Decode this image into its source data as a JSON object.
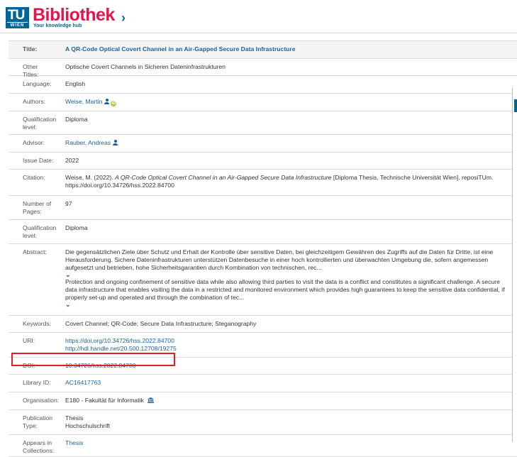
{
  "header": {
    "logo_tu": "TU",
    "logo_wien": "WIEN",
    "logo_name": "Bibliothek",
    "logo_tagline": "Your knowledge hub"
  },
  "record": {
    "title_label": "Title:",
    "title": "A QR-Code Optical Covert Channel in an Air-Gapped Secure Data Infrastructure",
    "other_titles_label": "Other Titles:",
    "other_titles": "Optische Covert Channels in Sicheren Dateninfrastrukturen",
    "language_label": "Language:",
    "language": "English",
    "authors_label": "Authors:",
    "authors": "Weise, Martin",
    "qualification_label": "Qualification level:",
    "qualification": "Diploma",
    "advisor_label": "Advisor:",
    "advisor": "Rauber, Andreas",
    "issue_date_label": "Issue Date:",
    "issue_date": "2022",
    "citation_label": "Citation:",
    "citation_prefix": "Weise, M. (2022).",
    "citation_title": "A QR-Code Optical Covert Channel in an Air-Gapped Secure Data Infrastructure",
    "citation_suffix": "[Diploma Thesis, Technische Universität Wien]. reposiTUm. https://doi.org/10.34726/hss.2022.84700",
    "pages_label": "Number of Pages:",
    "pages": "97",
    "qualification2_label": "Qualification level:",
    "qualification2": "Diploma",
    "abstract_label": "Abstract:",
    "abstract_de": "Die gegensätzlichen Ziele über Schutz und Erhalt der Kontrolle über sensitive Daten, bei gleichzeitigem Gewähren des Zugriffs auf die Daten für Dritte, ist eine Herausforderung. Sichere Dateninfrastrukturen unterstützen Datenbesuche in einer hoch kontrollierten und überwachten Umgebung die, sofern angemessen aufgesetzt und betrieben, hohe Sicherheitsgarantien durch Kombination von technischen, rec...",
    "abstract_en": "Protection and ongoing confinement of sensitive data while also allowing third parties to visit the data is a conflict and constitutes a significant challenge. A secure data infrastructure that enables visiting the data in a restricted and monitored environment which provides high guarantees to keep the sensitive data confidential, if properly set-up and operated and through the combination of tec...",
    "keywords_label": "Keywords:",
    "keywords": "Covert Channel; QR-Code; Secure Data Infrastructure; Steganography",
    "uri_label": "URI:",
    "uri_1": "https://doi.org/10.34726/hss.2022.84700",
    "uri_2": "http://hdl.handle.net/20.500.12708/19275",
    "doi_label": "DOI:",
    "doi": "10.34726/hss.2022.84700",
    "library_id_label": "Library ID:",
    "library_id": "AC16417763",
    "organisation_label": "Organisation:",
    "organisation": "E180 - Fakultät für Informatik",
    "pub_type_label": "Publication Type:",
    "pub_type_1": "Thesis",
    "pub_type_2": "Hochschulschrift",
    "collections_label": "Appears in Collections:",
    "collections": "Thesis"
  },
  "colors": {
    "link": "#1a5f9e",
    "brand_red": "#e4154b",
    "brand_blue": "#006699",
    "highlight": "#e02020"
  },
  "icons": {
    "author_person": "person-icon",
    "author_orcid": "orcid-icon",
    "advisor_person": "person-icon",
    "organisation": "institution-icon",
    "expand": "chevron-down-icon"
  }
}
